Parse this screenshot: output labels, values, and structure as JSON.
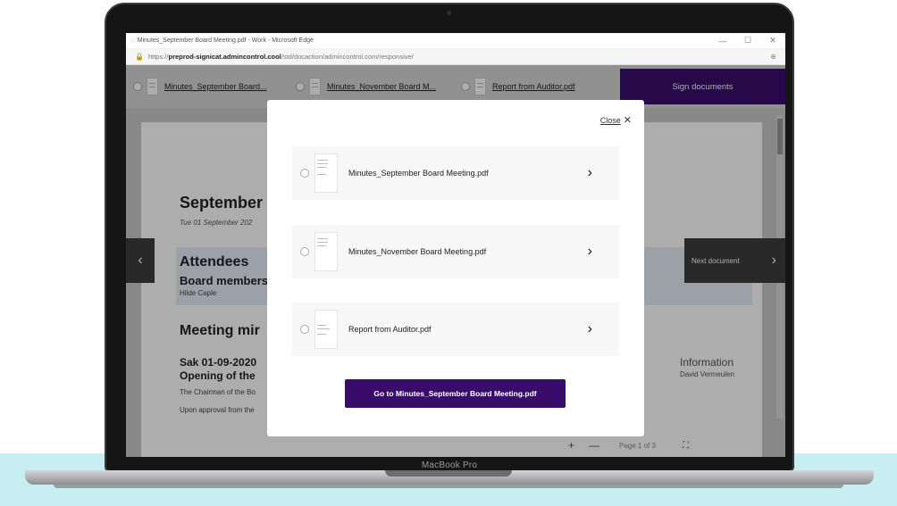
{
  "browser": {
    "window_title": "Minutes_September Board Meeting.pdf - Work - Microsoft Edge",
    "url_prefix": "https://",
    "url_host": "preprod-signicat.admincontrol.cool",
    "url_path": "/std/docaction/admincontrol.com/responsive/",
    "minimize": "—",
    "restore": "☐",
    "close": "✕",
    "lock_icon": "🔒",
    "zoom_icon": "⊕"
  },
  "tabs": [
    {
      "label": "Minutes_September Board..."
    },
    {
      "label": "Minutes_November Board M..."
    },
    {
      "label": "Report from Auditor.pdf"
    }
  ],
  "sign_button": "Sign documents",
  "document": {
    "heading": "September r",
    "subheading": "Tue 01 September 202",
    "attendees": "Attendees",
    "board_members": "Board members",
    "member": "Hilde Caple",
    "minutes": "Meeting mir",
    "sak": "Sak 01-09-2020",
    "opening": "Opening of the",
    "para1": "The Chairman of the Bo",
    "para2": "Upon approval from the",
    "info_heading": "Information",
    "info_name": "David Vermeulen"
  },
  "nav": {
    "prev": "‹",
    "next_label": "Next document",
    "next": "›"
  },
  "viewer_toolbar": {
    "zoom_in": "+",
    "zoom_out": "—",
    "page": "Page 1 of 3",
    "fullscreen": "⛶"
  },
  "modal": {
    "close": "Close",
    "close_icon": "✕",
    "items": [
      {
        "name": "Minutes_September Board Meeting.pdf"
      },
      {
        "name": "Minutes_November Board Meeting.pdf"
      },
      {
        "name": "Report from Auditor.pdf"
      }
    ],
    "chevron": "›",
    "go_button": "Go to Minutes_September Board Meeting.pdf"
  },
  "device_label": "MacBook Pro",
  "colors": {
    "accent": "#3a0c6a"
  }
}
